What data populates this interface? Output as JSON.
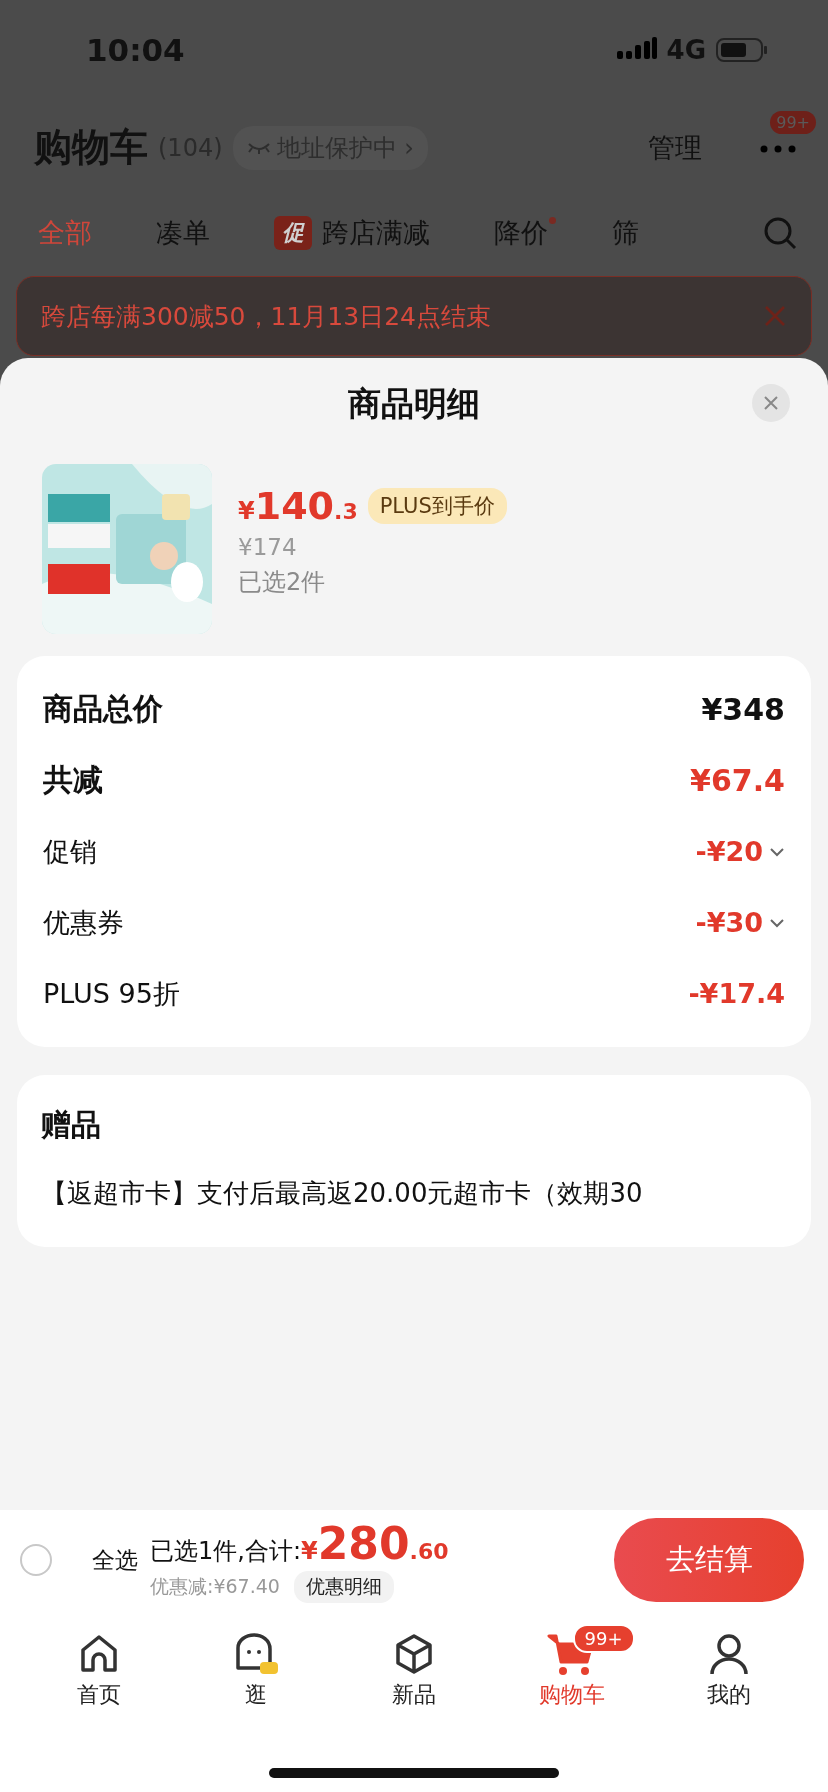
{
  "status_bar": {
    "time": "10:04",
    "network": "4G"
  },
  "header": {
    "title": "购物车",
    "count": "(104)",
    "address_chip": {
      "label": "地址保护中",
      "chevron": "›"
    },
    "manage": "管理",
    "more_badge": "99+"
  },
  "tabs": [
    {
      "label": "全部",
      "selected": true
    },
    {
      "label": "凑单",
      "selected": false
    },
    {
      "label": "跨店满减",
      "badge": "促",
      "selected": false
    },
    {
      "label": "降价",
      "dot": true,
      "selected": false
    },
    {
      "label": "筛",
      "selected": false
    }
  ],
  "banner": {
    "text": "跨店每满300减50，11月13日24点结束"
  },
  "sheet": {
    "title": "商品明细",
    "product": {
      "price": {
        "symbol": "¥",
        "integer": "140",
        "decimal": ".3"
      },
      "price_tag": "PLUS到手价",
      "original_price": "¥174",
      "quantity": "已选2件"
    },
    "price_rows": [
      {
        "kind": "total",
        "label": "商品总价",
        "amount": "¥348",
        "expandable": false
      },
      {
        "kind": "reduction",
        "label": "共减",
        "amount": "¥67.4",
        "expandable": false
      },
      {
        "kind": "item",
        "label": "促销",
        "amount": "-¥20",
        "expandable": true
      },
      {
        "kind": "item",
        "label": "优惠券",
        "amount": "-¥30",
        "expandable": true
      },
      {
        "kind": "item",
        "label": "PLUS 95折",
        "amount": "-¥17.4",
        "expandable": false
      }
    ],
    "gift": {
      "title": "赠品",
      "text": "【返超市卡】支付后最高返20.00元超市卡（效期30"
    }
  },
  "checkout_bar": {
    "select_all": {
      "label": "全选",
      "checked": false
    },
    "summary": "已选1件,合计:",
    "total": {
      "symbol": "¥",
      "integer": "280",
      "decimal": ".60"
    },
    "discount": "优惠减:¥67.40",
    "discount_detail": "优惠明细",
    "button": "去结算"
  },
  "tab_bar": [
    {
      "kind": "home",
      "label": "首页",
      "selected": false
    },
    {
      "kind": "browse",
      "label": "逛",
      "selected": false
    },
    {
      "kind": "new",
      "label": "新品",
      "selected": false
    },
    {
      "kind": "cart",
      "label": "购物车",
      "badge": "99+",
      "selected": true
    },
    {
      "kind": "profile",
      "label": "我的",
      "selected": false
    }
  ]
}
